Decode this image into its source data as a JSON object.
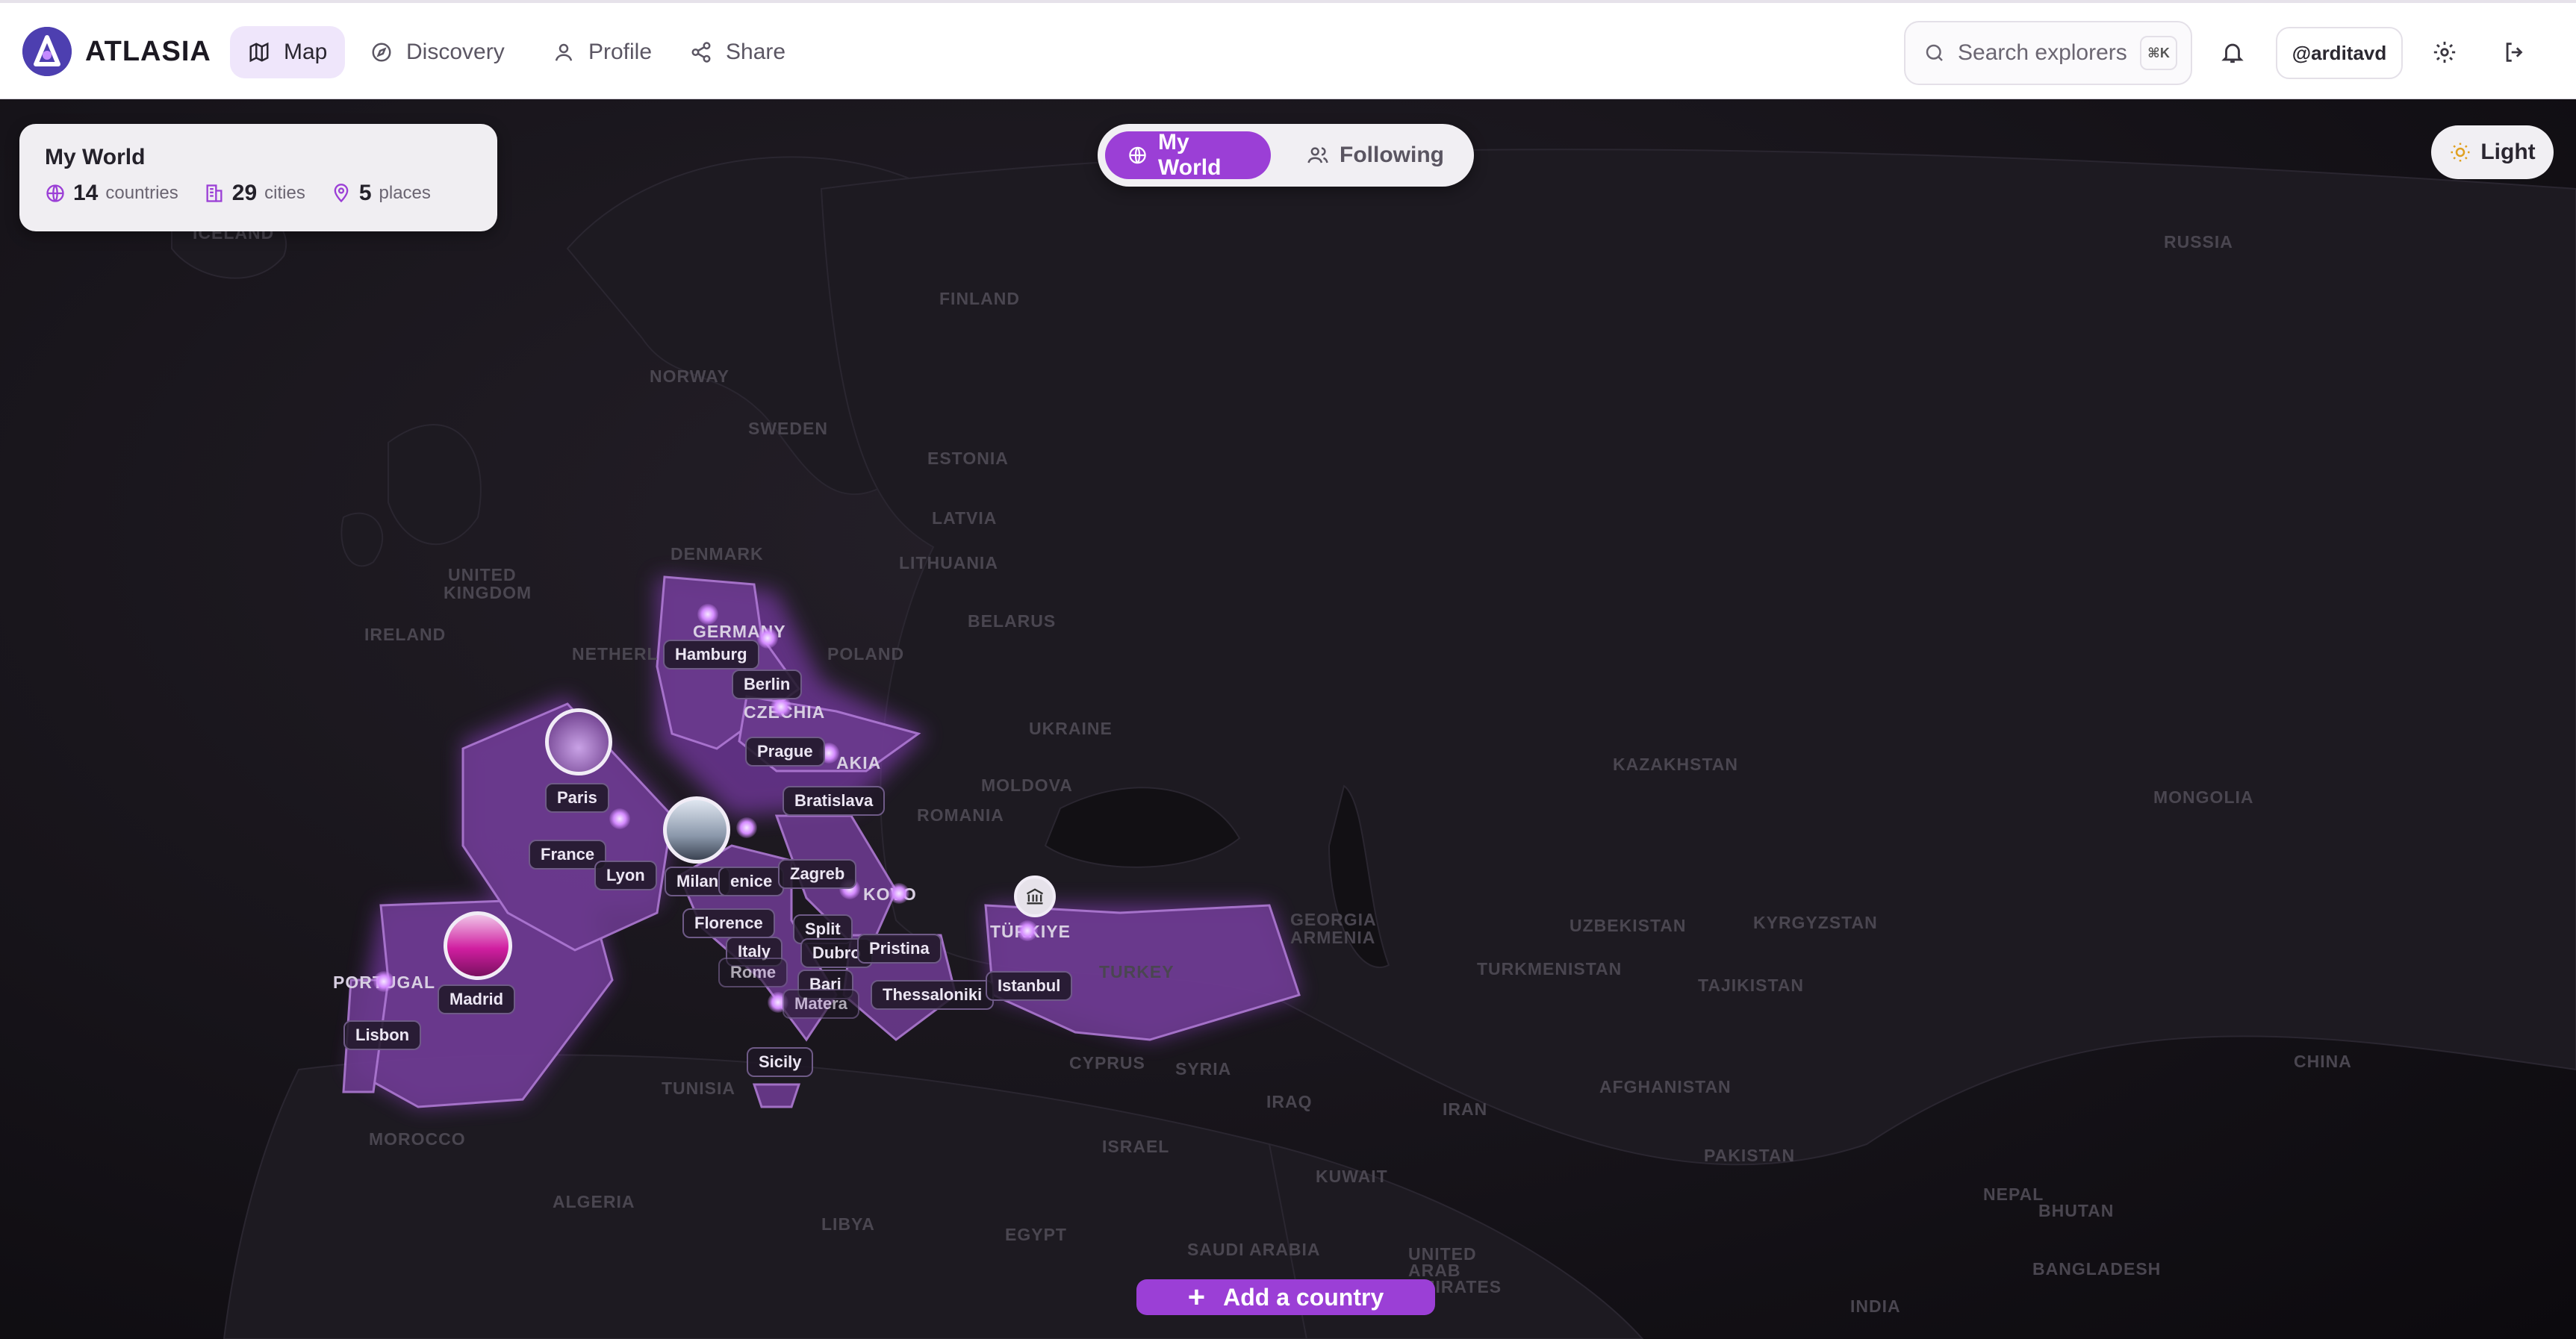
{
  "app": {
    "name": "ATLASIA"
  },
  "nav": {
    "items": [
      {
        "label": "Map",
        "icon": "map-icon",
        "active": true
      },
      {
        "label": "Discovery",
        "icon": "compass-icon"
      },
      {
        "label": "Profile",
        "icon": "user-icon"
      },
      {
        "label": "Share",
        "icon": "share-icon"
      }
    ]
  },
  "search": {
    "placeholder": "Search explorers",
    "shortcut": "⌘K"
  },
  "user": {
    "handle": "@arditavd"
  },
  "stats": {
    "title": "My World",
    "countries": {
      "count": "14",
      "label": "countries"
    },
    "cities": {
      "count": "29",
      "label": "cities"
    },
    "places": {
      "count": "5",
      "label": "places"
    }
  },
  "view_toggle": {
    "my_world": "My World",
    "following": "Following"
  },
  "theme": {
    "label": "Light"
  },
  "add_country": {
    "label": "Add a country"
  },
  "colors": {
    "accent": "#9b3fd6",
    "visited_fill": "#6b3a8e",
    "map_bg": "#17141a"
  },
  "map": {
    "country_labels": [
      "ICELAND",
      "FINLAND",
      "NORWAY",
      "SWEDEN",
      "ESTONIA",
      "LATVIA",
      "LITHUANIA",
      "DENMARK",
      "UNITED",
      "KINGDOM",
      "IRELAND",
      "NETHERL",
      "BELARUS",
      "POLAND",
      "GERMANY",
      "CZECHIA",
      "UKRAINE",
      "AKIA",
      "MOLDOVA",
      "ROMANIA",
      "KOVO",
      "TÜRKIYE",
      "TURKEY",
      "GEORGIA",
      "ARMENIA",
      "PORTUGAL",
      "TUNISIA",
      "MOROCCO",
      "ALGERIA",
      "LIBYA",
      "EGYPT",
      "CYPRUS",
      "SYRIA",
      "IRAQ",
      "IRAN",
      "ISRAEL",
      "KUWAIT",
      "SAUDI ARABIA",
      "RUSSIA",
      "KAZAKHSTAN",
      "UZBEKISTAN",
      "KYRGYZSTAN",
      "TURKMENISTAN",
      "TAJIKISTAN",
      "AFGHANISTAN",
      "PAKISTAN",
      "MONGOLIA",
      "CHINA",
      "NEPAL",
      "BHUTAN",
      "BANGLADESH",
      "INDIA",
      "UNITED ARAB EMIRATES"
    ],
    "city_pins": [
      "Hamburg",
      "Berlin",
      "Prague",
      "Bratislava",
      "Paris",
      "France",
      "Lyon",
      "Milan",
      "enice",
      "Zagreb",
      "Florence",
      "Split",
      "Italy",
      "Dubro",
      "Pristina",
      "Rome",
      "Bari",
      "Thessaloniki",
      "Istanbul",
      "Matera",
      "Sicily",
      "Madrid",
      "Lisbon"
    ]
  }
}
